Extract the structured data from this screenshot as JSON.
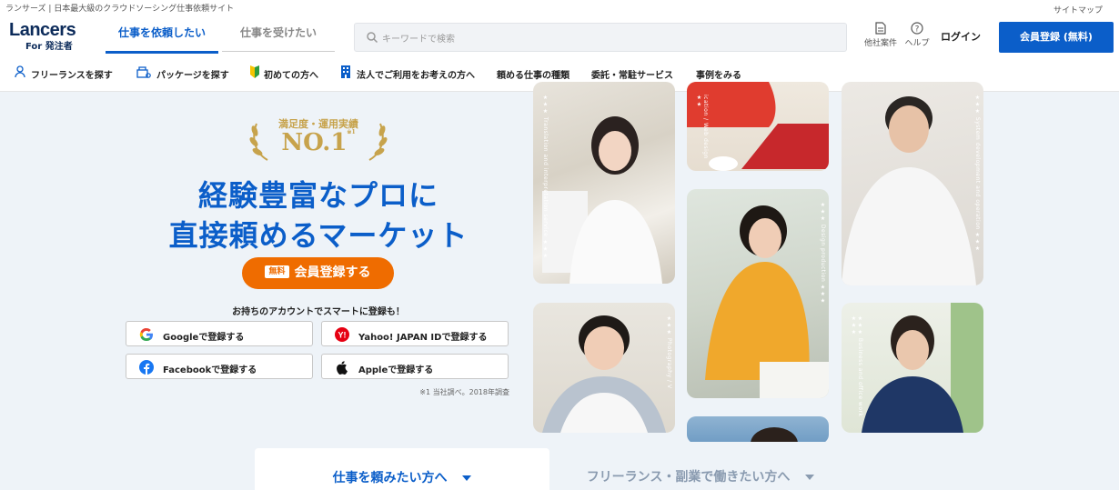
{
  "topbar": {
    "tagline": "ランサーズ | 日本最大級のクラウドソーシング仕事依頼サイト",
    "sitemap": "サイトマップ"
  },
  "header": {
    "logo_name": "Lancers",
    "logo_sub": "For 発注者",
    "tabs": [
      {
        "label": "仕事を依頼したい"
      },
      {
        "label": "仕事を受けたい"
      }
    ],
    "search_placeholder": "キーワードで検索",
    "other_jobs": "他社案件",
    "help": "ヘルプ",
    "login": "ログイン",
    "register": "会員登録 (無料)",
    "accent_color": "#0b5ec9"
  },
  "nav": {
    "items": [
      {
        "label": "フリーランスを探す",
        "icon": "person-icon"
      },
      {
        "label": "パッケージを探す",
        "icon": "package-icon"
      },
      {
        "label": "初めての方へ",
        "icon": "beginner-mark-icon"
      },
      {
        "label": "法人でご利用をお考えの方へ",
        "icon": "building-icon"
      },
      {
        "label": "頼める仕事の種類"
      },
      {
        "label": "委託・常駐サービス"
      },
      {
        "label": "事例をみる"
      }
    ]
  },
  "hero": {
    "award_top": "満足度・運用実績",
    "award_no1": "NO.1",
    "award_sup": "※1",
    "headline_1": "経験豊富なプロに",
    "headline_2": "直接頼めるマーケット",
    "cta_tag": "無料",
    "cta_label": "会員登録する",
    "subline": "お持ちのアカウントでスマートに登録も！",
    "social": [
      {
        "label": "Googleで登録する",
        "icon": "google-icon"
      },
      {
        "label": "Yahoo! JAPAN IDで登録する",
        "icon": "yahoo-icon"
      },
      {
        "label": "Facebookで登録する",
        "icon": "facebook-icon"
      },
      {
        "label": "Appleで登録する",
        "icon": "apple-icon"
      }
    ],
    "footnote": "※1 当社調べ。2018年調査"
  },
  "photos": [
    {
      "caption": "★★★ Translation and interpretation service ★★★"
    },
    {
      "caption": "ication / Web design ★★"
    },
    {
      "caption": "★★★ Design production ★★★"
    },
    {
      "caption": "★★★ System development and operation ★★★"
    },
    {
      "caption": "★★★ Photography / V"
    },
    {
      "caption": "★★★ Business and office work ★★★"
    }
  ],
  "bottom_tabs": [
    {
      "label": "仕事を頼みたい方へ"
    },
    {
      "label": "フリーランス・副業で働きたい方へ"
    }
  ]
}
